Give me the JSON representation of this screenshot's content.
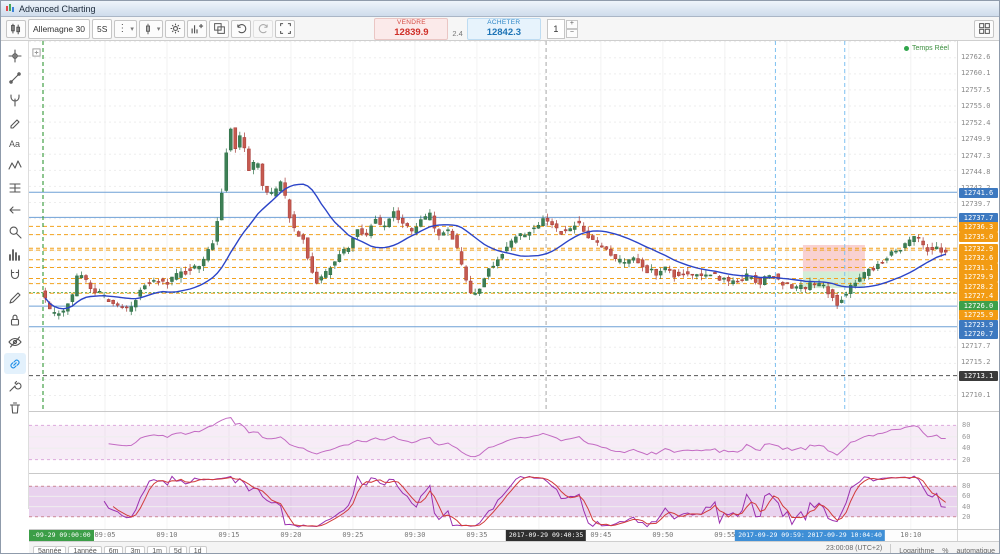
{
  "window": {
    "title": "Advanced Charting"
  },
  "toolbar": {
    "symbol": "Allemagne 30",
    "interval": "5S",
    "sell_label": "VENDRE",
    "sell_price": "12839.9",
    "spread": "2.4",
    "buy_label": "ACHETER",
    "buy_price": "12842.3",
    "qty": "1",
    "qty_increase": "+",
    "qty_decrease": "−"
  },
  "sidebar": {
    "tools": [
      {
        "name": "crosshair-tool"
      },
      {
        "name": "trendline-tool"
      },
      {
        "name": "pitchfork-tool"
      },
      {
        "name": "brush-tool"
      },
      {
        "name": "text-tool",
        "label": "Aa"
      },
      {
        "name": "elliott-wave-tool"
      },
      {
        "name": "fib-levels-tool"
      },
      {
        "name": "arrow-tool"
      },
      {
        "name": "zoom-tool"
      },
      {
        "name": "measure-tool"
      },
      {
        "name": "magnet-tool"
      },
      {
        "name": "pencil-tool"
      },
      {
        "name": "lock-tool"
      },
      {
        "name": "hide-drawings-tool"
      },
      {
        "name": "link-charts-tool",
        "active": true
      },
      {
        "name": "tools-tool"
      },
      {
        "name": "trash-tool"
      }
    ]
  },
  "chart": {
    "legend": "Temps Réel",
    "plain_ticks": [
      "12762.6",
      "12760.1",
      "12757.5",
      "12755.0",
      "12752.4",
      "12749.9",
      "12747.3",
      "12744.8",
      "12742.2",
      "12739.7",
      "12717.7",
      "12715.2",
      "12712.6",
      "12710.1"
    ]
  },
  "panes": [
    {
      "name": "rsi",
      "ticks": [
        "80",
        "60",
        "40",
        "20"
      ]
    },
    {
      "name": "stochastic",
      "ticks": [
        "80",
        "60",
        "40",
        "20"
      ]
    }
  ],
  "footer": {
    "ranges": [
      "5année",
      "1année",
      "6m",
      "3m",
      "1m",
      "5d",
      "1d"
    ],
    "clock": "23:00:08 (UTC+2)",
    "options": [
      "Logarithme",
      "%",
      "automatique"
    ]
  },
  "chart_data": {
    "type": "candlestick",
    "symbol": "Allemagne 30",
    "interval": "5S",
    "x_axis": {
      "start": "09:00",
      "end": "10:13",
      "minutes_span": 73
    },
    "y_axis": {
      "min": 12707.6,
      "max": 12765.1,
      "tick_step": 2.5
    },
    "n_candles": 200,
    "ma_period": 20,
    "rsi_period": 14,
    "stoch_k": 14,
    "stoch_d": 3,
    "time_labels": [
      {
        "label": "09:05",
        "t": 5
      },
      {
        "label": "09:10",
        "t": 10
      },
      {
        "label": "09:15",
        "t": 15
      },
      {
        "label": "09:20",
        "t": 20
      },
      {
        "label": "09:25",
        "t": 25
      },
      {
        "label": "09:30",
        "t": 30
      },
      {
        "label": "09:35",
        "t": 35
      },
      {
        "label": "09:40",
        "t": 40
      },
      {
        "label": "09:45",
        "t": 45
      },
      {
        "label": "09:50",
        "t": 50
      },
      {
        "label": "09:55",
        "t": 55
      },
      {
        "label": "10:10",
        "t": 70
      }
    ],
    "stamps": [
      {
        "text": "-09-29 09:00:00",
        "t": 0,
        "color": "green"
      },
      {
        "text": "2017-09-29 09:40:35",
        "t": 40.58,
        "color": "black"
      },
      {
        "text": "2017-09-29 09:59:05",
        "t": 59.08,
        "color": "blue"
      },
      {
        "text": "2017-09-29 10:04:40",
        "t": 64.67,
        "color": "blue"
      }
    ],
    "levels": [
      {
        "price": 12741.6,
        "label": "12741.6",
        "color": "blue",
        "style": "solid"
      },
      {
        "price": 12737.7,
        "label": "12737.7",
        "color": "blue",
        "style": "solid"
      },
      {
        "price": 12736.3,
        "label": "12736.3",
        "color": "orange",
        "style": "dashed"
      },
      {
        "price": 12735.0,
        "label": "12735.0",
        "color": "orange",
        "style": "dashed"
      },
      {
        "price": 12732.9,
        "label": "12732.9",
        "color": "orange",
        "style": "dashed"
      },
      {
        "price": 12732.6,
        "label": "12732.6",
        "color": "orange",
        "style": "dashed"
      },
      {
        "price": 12731.1,
        "label": "12731.1",
        "color": "orange",
        "style": "dashed"
      },
      {
        "price": 12729.9,
        "label": "12729.9",
        "color": "orange",
        "style": "dashed"
      },
      {
        "price": 12728.2,
        "label": "12728.2",
        "color": "orange",
        "style": "dashed"
      },
      {
        "price": 12727.4,
        "label": "12727.4",
        "color": "orange",
        "style": "dashed"
      },
      {
        "price": 12726.0,
        "label": "12726.0",
        "color": "green",
        "style": "dotted"
      },
      {
        "price": 12725.9,
        "label": "12725.9",
        "color": "orange",
        "style": "dashed"
      },
      {
        "price": 12723.9,
        "label": "12723.9",
        "color": "blue",
        "style": "solid"
      },
      {
        "price": 12720.7,
        "label": "12720.7",
        "color": "blue",
        "style": "solid"
      },
      {
        "price": 12713.1,
        "label": "12713.1",
        "color": "black",
        "style": "dashed"
      }
    ],
    "vlines": [
      {
        "t": 0,
        "color": "green"
      },
      {
        "t": 40.58,
        "color": "gray"
      },
      {
        "t": 59.08,
        "color": "blue"
      },
      {
        "t": 64.67,
        "color": "blue"
      }
    ],
    "zones": [
      {
        "t1": 61.3,
        "t2": 66.3,
        "p1": 12729.3,
        "p2": 12733.4,
        "color": "red"
      },
      {
        "t1": 61.3,
        "t2": 66.3,
        "p1": 12726.7,
        "p2": 12729.3,
        "color": "green"
      }
    ],
    "anchors": [
      [
        0,
        12726.5
      ],
      [
        0.7,
        12723.2
      ],
      [
        1.2,
        12722.3
      ],
      [
        2,
        12723.5
      ],
      [
        2.6,
        12726
      ],
      [
        3,
        12729.3
      ],
      [
        3.5,
        12728
      ],
      [
        4,
        12726.8
      ],
      [
        5,
        12725.4
      ],
      [
        6,
        12723.8
      ],
      [
        7,
        12723.3
      ],
      [
        7.5,
        12724.5
      ],
      [
        8,
        12726.6
      ],
      [
        9,
        12728.2
      ],
      [
        10,
        12727.4
      ],
      [
        11,
        12728.6
      ],
      [
        12,
        12729.6
      ],
      [
        13,
        12730.8
      ],
      [
        14,
        12734.5
      ],
      [
        14.7,
        12743
      ],
      [
        15.2,
        12752.5
      ],
      [
        15.7,
        12748.5
      ],
      [
        16.2,
        12751
      ],
      [
        16.8,
        12745
      ],
      [
        17.4,
        12746.5
      ],
      [
        18,
        12742
      ],
      [
        18.8,
        12741.2
      ],
      [
        19.4,
        12743.2
      ],
      [
        20,
        12738.5
      ],
      [
        20.6,
        12734.8
      ],
      [
        21.2,
        12734.2
      ],
      [
        21.8,
        12729
      ],
      [
        22.4,
        12727.6
      ],
      [
        23,
        12729
      ],
      [
        24,
        12731.6
      ],
      [
        25,
        12733.6
      ],
      [
        25.6,
        12735.8
      ],
      [
        26.2,
        12735
      ],
      [
        27,
        12737.6
      ],
      [
        27.6,
        12736
      ],
      [
        28.4,
        12738.4
      ],
      [
        29,
        12737.4
      ],
      [
        30,
        12735.6
      ],
      [
        30.6,
        12737.2
      ],
      [
        31.4,
        12738
      ],
      [
        32,
        12735
      ],
      [
        32.8,
        12735.8
      ],
      [
        33.4,
        12734
      ],
      [
        34,
        12729.6
      ],
      [
        34.6,
        12726
      ],
      [
        35.2,
        12725.6
      ],
      [
        36,
        12729.4
      ],
      [
        36.8,
        12731
      ],
      [
        37.6,
        12733.4
      ],
      [
        38.4,
        12734.8
      ],
      [
        39.2,
        12735.4
      ],
      [
        40,
        12736.6
      ],
      [
        40.8,
        12737.4
      ],
      [
        41.6,
        12735.6
      ],
      [
        42.4,
        12735.2
      ],
      [
        43.2,
        12737
      ],
      [
        44,
        12735
      ],
      [
        44.8,
        12733.4
      ],
      [
        45.6,
        12733
      ],
      [
        46.4,
        12731
      ],
      [
        47.2,
        12730.6
      ],
      [
        48,
        12731.4
      ],
      [
        48.8,
        12729.6
      ],
      [
        49.6,
        12729
      ],
      [
        50.4,
        12729.8
      ],
      [
        51.2,
        12728.6
      ],
      [
        52,
        12729.4
      ],
      [
        53,
        12728.4
      ],
      [
        54,
        12729
      ],
      [
        55,
        12728
      ],
      [
        56,
        12727.6
      ],
      [
        57,
        12728.6
      ],
      [
        58,
        12727.6
      ],
      [
        59,
        12728.8
      ],
      [
        60,
        12727.2
      ],
      [
        61,
        12727
      ],
      [
        61.6,
        12726.6
      ],
      [
        62.2,
        12727.6
      ],
      [
        63,
        12727
      ],
      [
        63.6,
        12726
      ],
      [
        64.2,
        12724.2
      ],
      [
        64.8,
        12725.6
      ],
      [
        65.4,
        12727.2
      ],
      [
        66,
        12728.6
      ],
      [
        67,
        12729.6
      ],
      [
        68,
        12731
      ],
      [
        69,
        12732.6
      ],
      [
        70,
        12733.8
      ],
      [
        70.6,
        12734.6
      ],
      [
        71.2,
        12733.4
      ],
      [
        71.8,
        12732.4
      ],
      [
        72.4,
        12732.8
      ],
      [
        73,
        12731.9
      ]
    ]
  }
}
